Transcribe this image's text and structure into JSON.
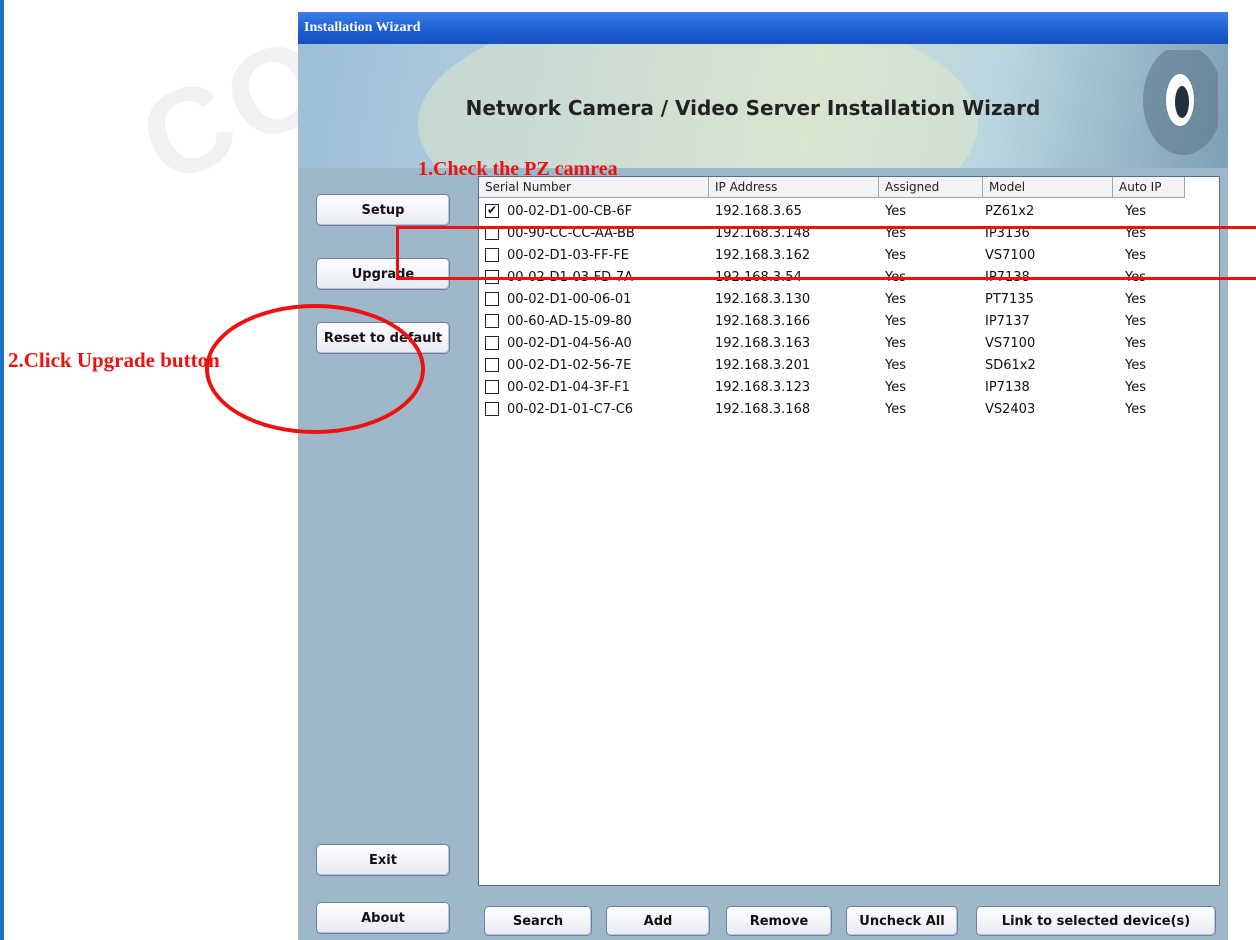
{
  "window": {
    "title": "Installation Wizard"
  },
  "banner": {
    "title": "Network Camera / Video Server Installation Wizard"
  },
  "sidebar": {
    "setup": "Setup",
    "upgrade": "Upgrade",
    "reset": "Reset to default",
    "exit": "Exit",
    "about": "About"
  },
  "list": {
    "headers": [
      "Serial Number",
      "IP Address",
      "Assigned",
      "Model",
      "Auto IP"
    ],
    "rows": [
      {
        "checked": true,
        "serial": "00-02-D1-00-CB-6F",
        "ip": "192.168.3.65",
        "assigned": "Yes",
        "model": "PZ61x2",
        "auto_ip": "Yes"
      },
      {
        "checked": false,
        "serial": "00-90-CC-CC-AA-BB",
        "ip": "192.168.3.148",
        "assigned": "Yes",
        "model": "IP3136",
        "auto_ip": "Yes"
      },
      {
        "checked": false,
        "serial": "00-02-D1-03-FF-FE",
        "ip": "192.168.3.162",
        "assigned": "Yes",
        "model": "VS7100",
        "auto_ip": "Yes"
      },
      {
        "checked": false,
        "serial": "00-02-D1-03-FD-7A",
        "ip": "192.168.3.54",
        "assigned": "Yes",
        "model": "IP7138",
        "auto_ip": "Yes"
      },
      {
        "checked": false,
        "serial": "00-02-D1-00-06-01",
        "ip": "192.168.3.130",
        "assigned": "Yes",
        "model": "PT7135",
        "auto_ip": "Yes"
      },
      {
        "checked": false,
        "serial": "00-60-AD-15-09-80",
        "ip": "192.168.3.166",
        "assigned": "Yes",
        "model": "IP7137",
        "auto_ip": "Yes"
      },
      {
        "checked": false,
        "serial": "00-02-D1-04-56-A0",
        "ip": "192.168.3.163",
        "assigned": "Yes",
        "model": "VS7100",
        "auto_ip": "Yes"
      },
      {
        "checked": false,
        "serial": "00-02-D1-02-56-7E",
        "ip": "192.168.3.201",
        "assigned": "Yes",
        "model": "SD61x2",
        "auto_ip": "Yes"
      },
      {
        "checked": false,
        "serial": "00-02-D1-04-3F-F1",
        "ip": "192.168.3.123",
        "assigned": "Yes",
        "model": "IP7138",
        "auto_ip": "Yes"
      },
      {
        "checked": false,
        "serial": "00-02-D1-01-C7-C6",
        "ip": "192.168.3.168",
        "assigned": "Yes",
        "model": "VS2403",
        "auto_ip": "Yes"
      }
    ]
  },
  "bottom": {
    "search": "Search",
    "add": "Add",
    "remove": "Remove",
    "uncheck_all": "Uncheck All",
    "link": "Link to selected device(s)"
  },
  "annotations": {
    "step1": "1.Check the  PZ  camrea",
    "step2": "2.Click Upgrade button",
    "color": "#ee1111"
  },
  "watermark": "CO"
}
